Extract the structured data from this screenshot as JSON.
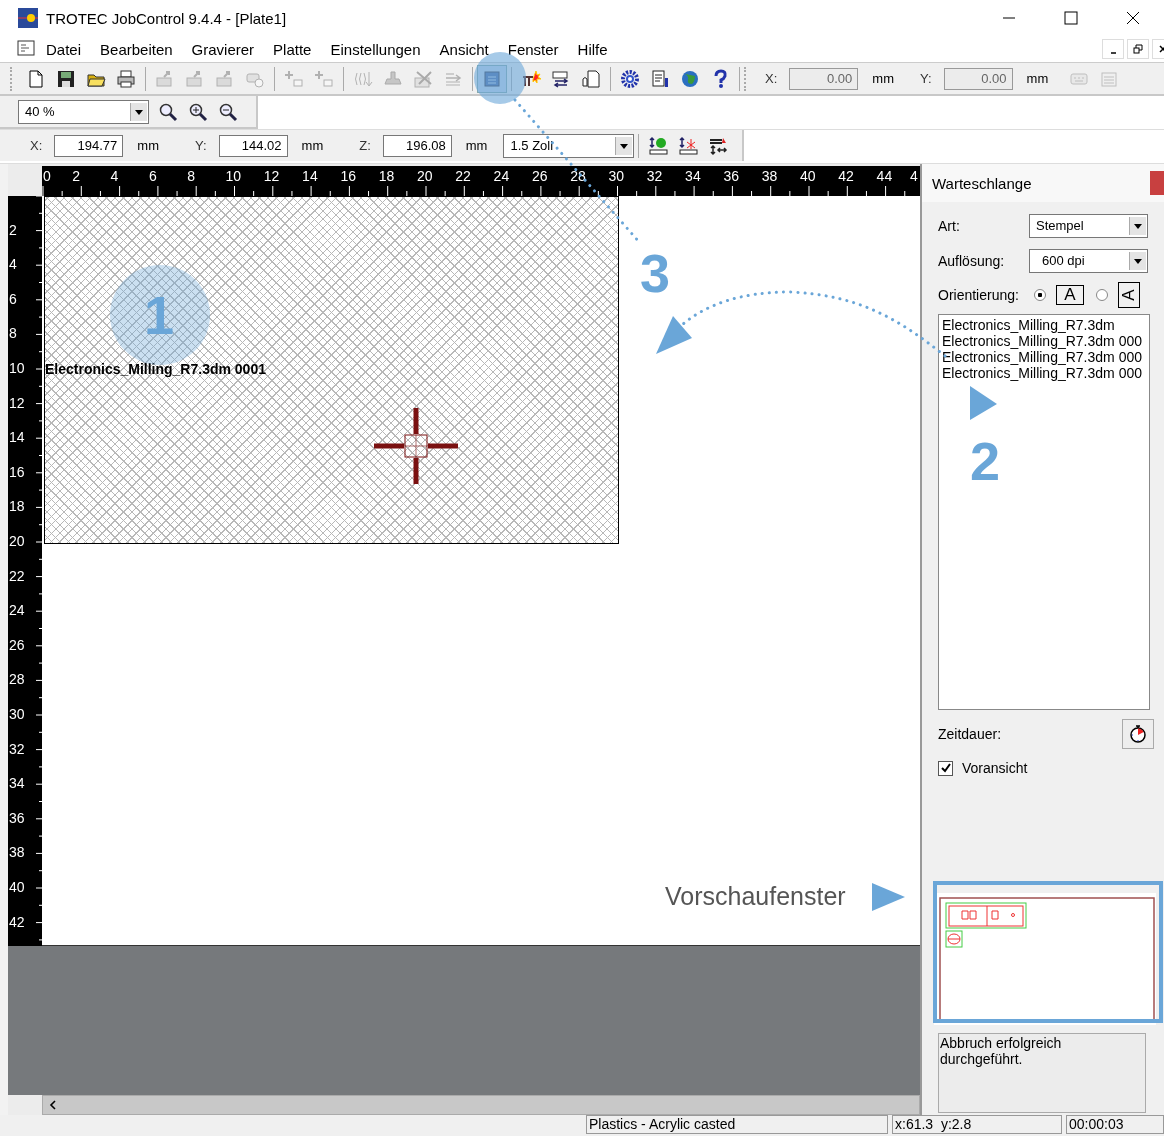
{
  "window": {
    "title": "TROTEC JobControl 9.4.4 - [Plate1]"
  },
  "menu": [
    "Datei",
    "Bearbeiten",
    "Gravierer",
    "Platte",
    "Einstellungen",
    "Ansicht",
    "Fenster",
    "Hilfe"
  ],
  "toolbar": {
    "groups": [
      [
        {
          "disabled": false,
          "selected": false
        },
        {
          "disabled": false,
          "selected": false
        },
        {
          "disabled": false,
          "selected": false
        },
        {
          "disabled": false,
          "selected": false
        }
      ],
      [
        {
          "disabled": true,
          "selected": false
        },
        {
          "disabled": true,
          "selected": false
        },
        {
          "disabled": true,
          "selected": false
        },
        {
          "disabled": true,
          "selected": false
        }
      ],
      [
        {
          "disabled": true,
          "selected": false
        },
        {
          "disabled": true,
          "selected": false
        }
      ],
      [
        {
          "disabled": true,
          "selected": false
        },
        {
          "disabled": true,
          "selected": false
        },
        {
          "disabled": true,
          "selected": false
        },
        {
          "disabled": true,
          "selected": false
        }
      ],
      [
        {
          "disabled": false,
          "selected": true
        }
      ],
      [
        {
          "disabled": false,
          "selected": false
        },
        {
          "disabled": false,
          "selected": false
        },
        {
          "disabled": false,
          "selected": false
        }
      ],
      [
        {
          "disabled": false,
          "selected": false
        },
        {
          "disabled": false,
          "selected": false
        },
        {
          "disabled": false,
          "selected": false
        },
        {
          "disabled": false,
          "selected": false
        }
      ]
    ],
    "position": [
      {
        "label": "X:",
        "value": "0.00",
        "unit": "mm",
        "disabled": true
      },
      {
        "label": "Y:",
        "value": "0.00",
        "unit": "mm",
        "disabled": true
      }
    ],
    "extra_tools": [
      {
        "disabled": true
      },
      {
        "disabled": true
      }
    ]
  },
  "zoom_bar": {
    "zoom": "40 %"
  },
  "coordinate_bar": {
    "fields": [
      {
        "label": "X:",
        "value": "194.77",
        "unit": "mm"
      },
      {
        "label": "Y:",
        "value": "144.02",
        "unit": "mm"
      },
      {
        "label": "Z:",
        "value": "196.08",
        "unit": "mm"
      }
    ],
    "thickness": "1.5 Zoll"
  },
  "rulers": {
    "horizontal": [
      "0",
      "2",
      "4",
      "6",
      "8",
      "10",
      "12",
      "14",
      "16",
      "18",
      "20",
      "22",
      "24",
      "26",
      "28",
      "30",
      "32",
      "34",
      "36",
      "38",
      "40",
      "42",
      "44",
      "4"
    ],
    "vertical": [
      "2",
      "4",
      "6",
      "8",
      "10",
      "12",
      "14",
      "16",
      "18",
      "20",
      "22",
      "24",
      "26",
      "28",
      "30",
      "32",
      "34",
      "36",
      "38",
      "40",
      "42"
    ]
  },
  "plate": {
    "job_label": "Electronics_Milling_R7.3dm 0001"
  },
  "queue_panel": {
    "title": "Warteschlange",
    "type_label": "Art:",
    "type_value": "Stempel",
    "resolution_label": "Auflösung:",
    "resolution_value": "600 dpi",
    "orientation_label": "Orientierung:",
    "orientations": [
      {
        "kind": "landscape",
        "glyph": "A",
        "selected": true
      },
      {
        "kind": "portrait",
        "glyph": "A",
        "selected": false
      }
    ],
    "jobs": [
      "Electronics_Milling_R7.3dm",
      "Electronics_Milling_R7.3dm 000",
      "Electronics_Milling_R7.3dm 000",
      "Electronics_Milling_R7.3dm 000"
    ],
    "duration_label": "Zeitdauer:",
    "preview_checkbox": {
      "label": "Voransicht",
      "checked": true
    },
    "message": "Abbruch erfolgreich durchgeführt."
  },
  "status_bar": {
    "material": "Plastics - Acrylic casted",
    "position": "x:61.3  y:2.8",
    "time": "00:00:03"
  },
  "annotations": {
    "markers": [
      "1",
      "2",
      "3"
    ],
    "preview_label": "Vorschaufenster"
  }
}
